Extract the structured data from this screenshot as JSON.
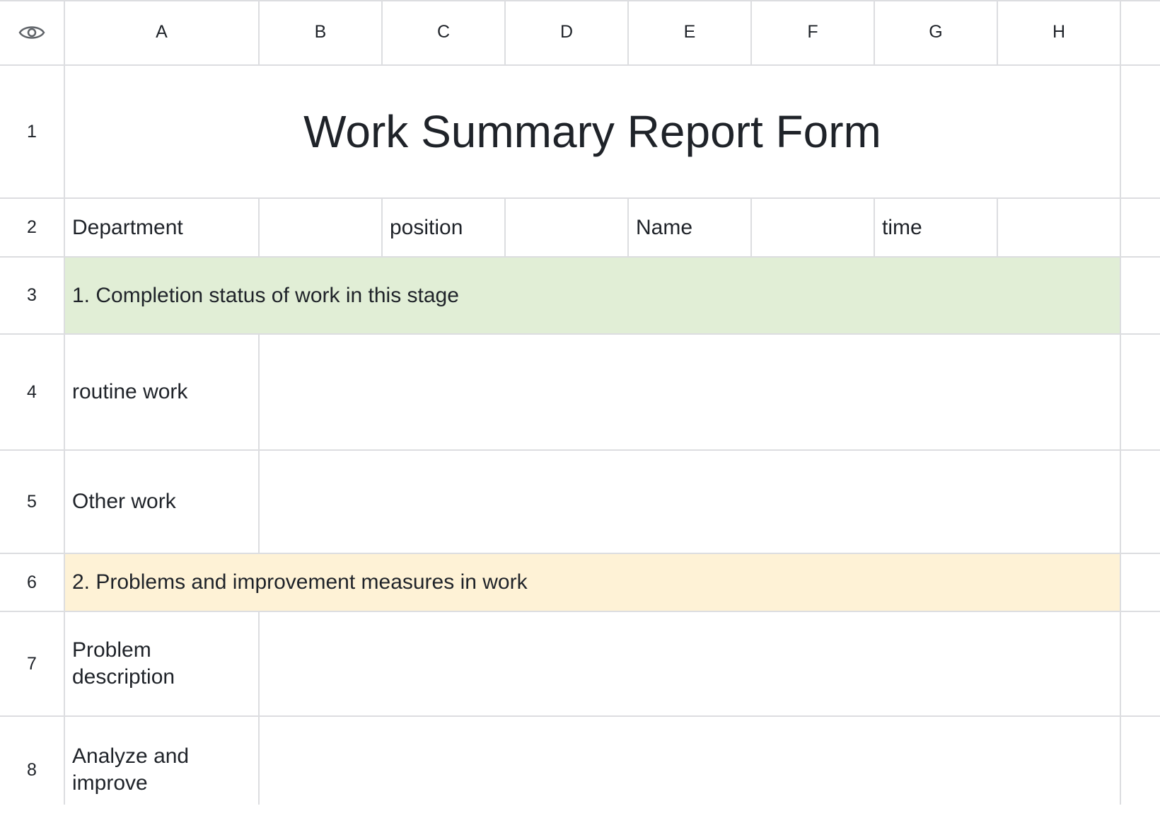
{
  "columns": [
    "A",
    "B",
    "C",
    "D",
    "E",
    "F",
    "G",
    "H"
  ],
  "rows": [
    "1",
    "2",
    "3",
    "4",
    "5",
    "6",
    "7",
    "8"
  ],
  "corner_icon": "eye-icon",
  "title": "Work Summary Report Form",
  "header_row": {
    "department": "Department",
    "position": "position",
    "name": "Name",
    "time": "time"
  },
  "section1": "1. Completion status of work in this stage",
  "section1_color": "#e1eed6",
  "routine_work": "routine work",
  "other_work": "Other work",
  "section2": "2. Problems and improvement measures in work",
  "section2_color": "#fef2d6",
  "problem_description": "Problem description",
  "analyze_improve": "Analyze and improve"
}
